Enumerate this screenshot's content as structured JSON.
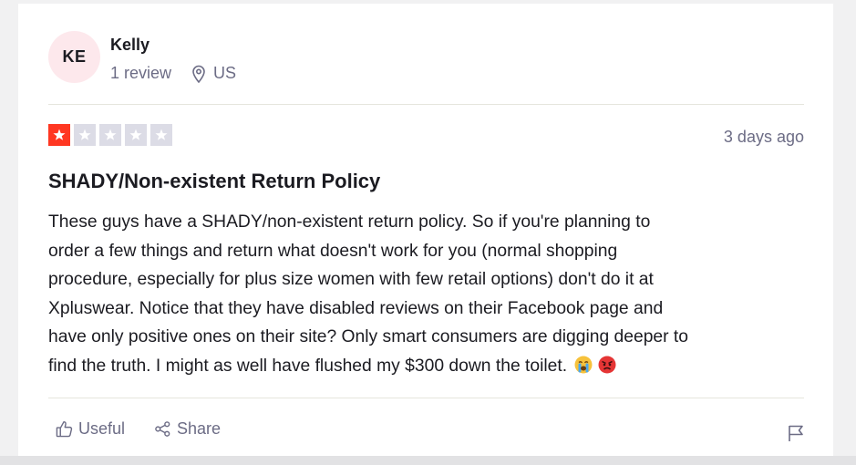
{
  "reviewer": {
    "initials": "KE",
    "name": "Kelly",
    "review_count": "1 review",
    "location": "US"
  },
  "review": {
    "rating": 1,
    "rating_max": 5,
    "date": "3 days ago",
    "title": "SHADY/Non-existent Return Policy",
    "body_lines": [
      "These guys have a SHADY/non-existent return policy. So if you're planning to",
      "order a few things and return what doesn't work for you (normal shopping",
      "procedure, especially for plus size women with few retail options) don't do it at",
      "Xpluswear. Notice that they have disabled reviews on their Facebook page and",
      "have only positive ones on their site? Only smart consumers are digging deeper to",
      "find the truth. I might as well have flushed my $300 down the toilet."
    ],
    "emojis": [
      "loudly-crying-face",
      "angry-face"
    ]
  },
  "actions": {
    "useful_label": "Useful",
    "share_label": "Share",
    "flag_icon": "flag-icon"
  },
  "colors": {
    "star_filled": "#ff3722",
    "star_empty": "#dcdce6",
    "text_primary": "#1b1b21",
    "text_secondary": "#6c6c85",
    "avatar_bg": "#fde8ec"
  }
}
